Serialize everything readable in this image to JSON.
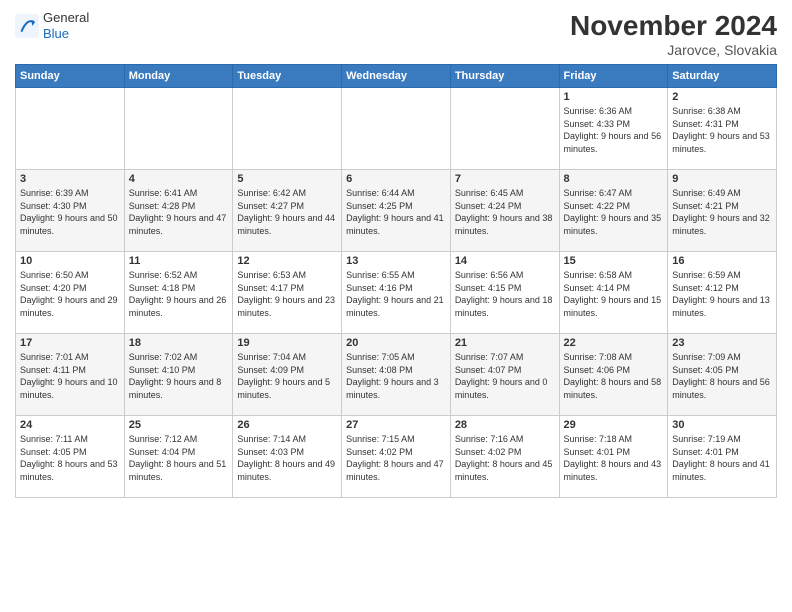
{
  "logo": {
    "general": "General",
    "blue": "Blue"
  },
  "header": {
    "month": "November 2024",
    "location": "Jarovce, Slovakia"
  },
  "weekdays": [
    "Sunday",
    "Monday",
    "Tuesday",
    "Wednesday",
    "Thursday",
    "Friday",
    "Saturday"
  ],
  "weeks": [
    [
      {
        "day": "",
        "info": ""
      },
      {
        "day": "",
        "info": ""
      },
      {
        "day": "",
        "info": ""
      },
      {
        "day": "",
        "info": ""
      },
      {
        "day": "",
        "info": ""
      },
      {
        "day": "1",
        "info": "Sunrise: 6:36 AM\nSunset: 4:33 PM\nDaylight: 9 hours and 56 minutes."
      },
      {
        "day": "2",
        "info": "Sunrise: 6:38 AM\nSunset: 4:31 PM\nDaylight: 9 hours and 53 minutes."
      }
    ],
    [
      {
        "day": "3",
        "info": "Sunrise: 6:39 AM\nSunset: 4:30 PM\nDaylight: 9 hours and 50 minutes."
      },
      {
        "day": "4",
        "info": "Sunrise: 6:41 AM\nSunset: 4:28 PM\nDaylight: 9 hours and 47 minutes."
      },
      {
        "day": "5",
        "info": "Sunrise: 6:42 AM\nSunset: 4:27 PM\nDaylight: 9 hours and 44 minutes."
      },
      {
        "day": "6",
        "info": "Sunrise: 6:44 AM\nSunset: 4:25 PM\nDaylight: 9 hours and 41 minutes."
      },
      {
        "day": "7",
        "info": "Sunrise: 6:45 AM\nSunset: 4:24 PM\nDaylight: 9 hours and 38 minutes."
      },
      {
        "day": "8",
        "info": "Sunrise: 6:47 AM\nSunset: 4:22 PM\nDaylight: 9 hours and 35 minutes."
      },
      {
        "day": "9",
        "info": "Sunrise: 6:49 AM\nSunset: 4:21 PM\nDaylight: 9 hours and 32 minutes."
      }
    ],
    [
      {
        "day": "10",
        "info": "Sunrise: 6:50 AM\nSunset: 4:20 PM\nDaylight: 9 hours and 29 minutes."
      },
      {
        "day": "11",
        "info": "Sunrise: 6:52 AM\nSunset: 4:18 PM\nDaylight: 9 hours and 26 minutes."
      },
      {
        "day": "12",
        "info": "Sunrise: 6:53 AM\nSunset: 4:17 PM\nDaylight: 9 hours and 23 minutes."
      },
      {
        "day": "13",
        "info": "Sunrise: 6:55 AM\nSunset: 4:16 PM\nDaylight: 9 hours and 21 minutes."
      },
      {
        "day": "14",
        "info": "Sunrise: 6:56 AM\nSunset: 4:15 PM\nDaylight: 9 hours and 18 minutes."
      },
      {
        "day": "15",
        "info": "Sunrise: 6:58 AM\nSunset: 4:14 PM\nDaylight: 9 hours and 15 minutes."
      },
      {
        "day": "16",
        "info": "Sunrise: 6:59 AM\nSunset: 4:12 PM\nDaylight: 9 hours and 13 minutes."
      }
    ],
    [
      {
        "day": "17",
        "info": "Sunrise: 7:01 AM\nSunset: 4:11 PM\nDaylight: 9 hours and 10 minutes."
      },
      {
        "day": "18",
        "info": "Sunrise: 7:02 AM\nSunset: 4:10 PM\nDaylight: 9 hours and 8 minutes."
      },
      {
        "day": "19",
        "info": "Sunrise: 7:04 AM\nSunset: 4:09 PM\nDaylight: 9 hours and 5 minutes."
      },
      {
        "day": "20",
        "info": "Sunrise: 7:05 AM\nSunset: 4:08 PM\nDaylight: 9 hours and 3 minutes."
      },
      {
        "day": "21",
        "info": "Sunrise: 7:07 AM\nSunset: 4:07 PM\nDaylight: 9 hours and 0 minutes."
      },
      {
        "day": "22",
        "info": "Sunrise: 7:08 AM\nSunset: 4:06 PM\nDaylight: 8 hours and 58 minutes."
      },
      {
        "day": "23",
        "info": "Sunrise: 7:09 AM\nSunset: 4:05 PM\nDaylight: 8 hours and 56 minutes."
      }
    ],
    [
      {
        "day": "24",
        "info": "Sunrise: 7:11 AM\nSunset: 4:05 PM\nDaylight: 8 hours and 53 minutes."
      },
      {
        "day": "25",
        "info": "Sunrise: 7:12 AM\nSunset: 4:04 PM\nDaylight: 8 hours and 51 minutes."
      },
      {
        "day": "26",
        "info": "Sunrise: 7:14 AM\nSunset: 4:03 PM\nDaylight: 8 hours and 49 minutes."
      },
      {
        "day": "27",
        "info": "Sunrise: 7:15 AM\nSunset: 4:02 PM\nDaylight: 8 hours and 47 minutes."
      },
      {
        "day": "28",
        "info": "Sunrise: 7:16 AM\nSunset: 4:02 PM\nDaylight: 8 hours and 45 minutes."
      },
      {
        "day": "29",
        "info": "Sunrise: 7:18 AM\nSunset: 4:01 PM\nDaylight: 8 hours and 43 minutes."
      },
      {
        "day": "30",
        "info": "Sunrise: 7:19 AM\nSunset: 4:01 PM\nDaylight: 8 hours and 41 minutes."
      }
    ]
  ]
}
